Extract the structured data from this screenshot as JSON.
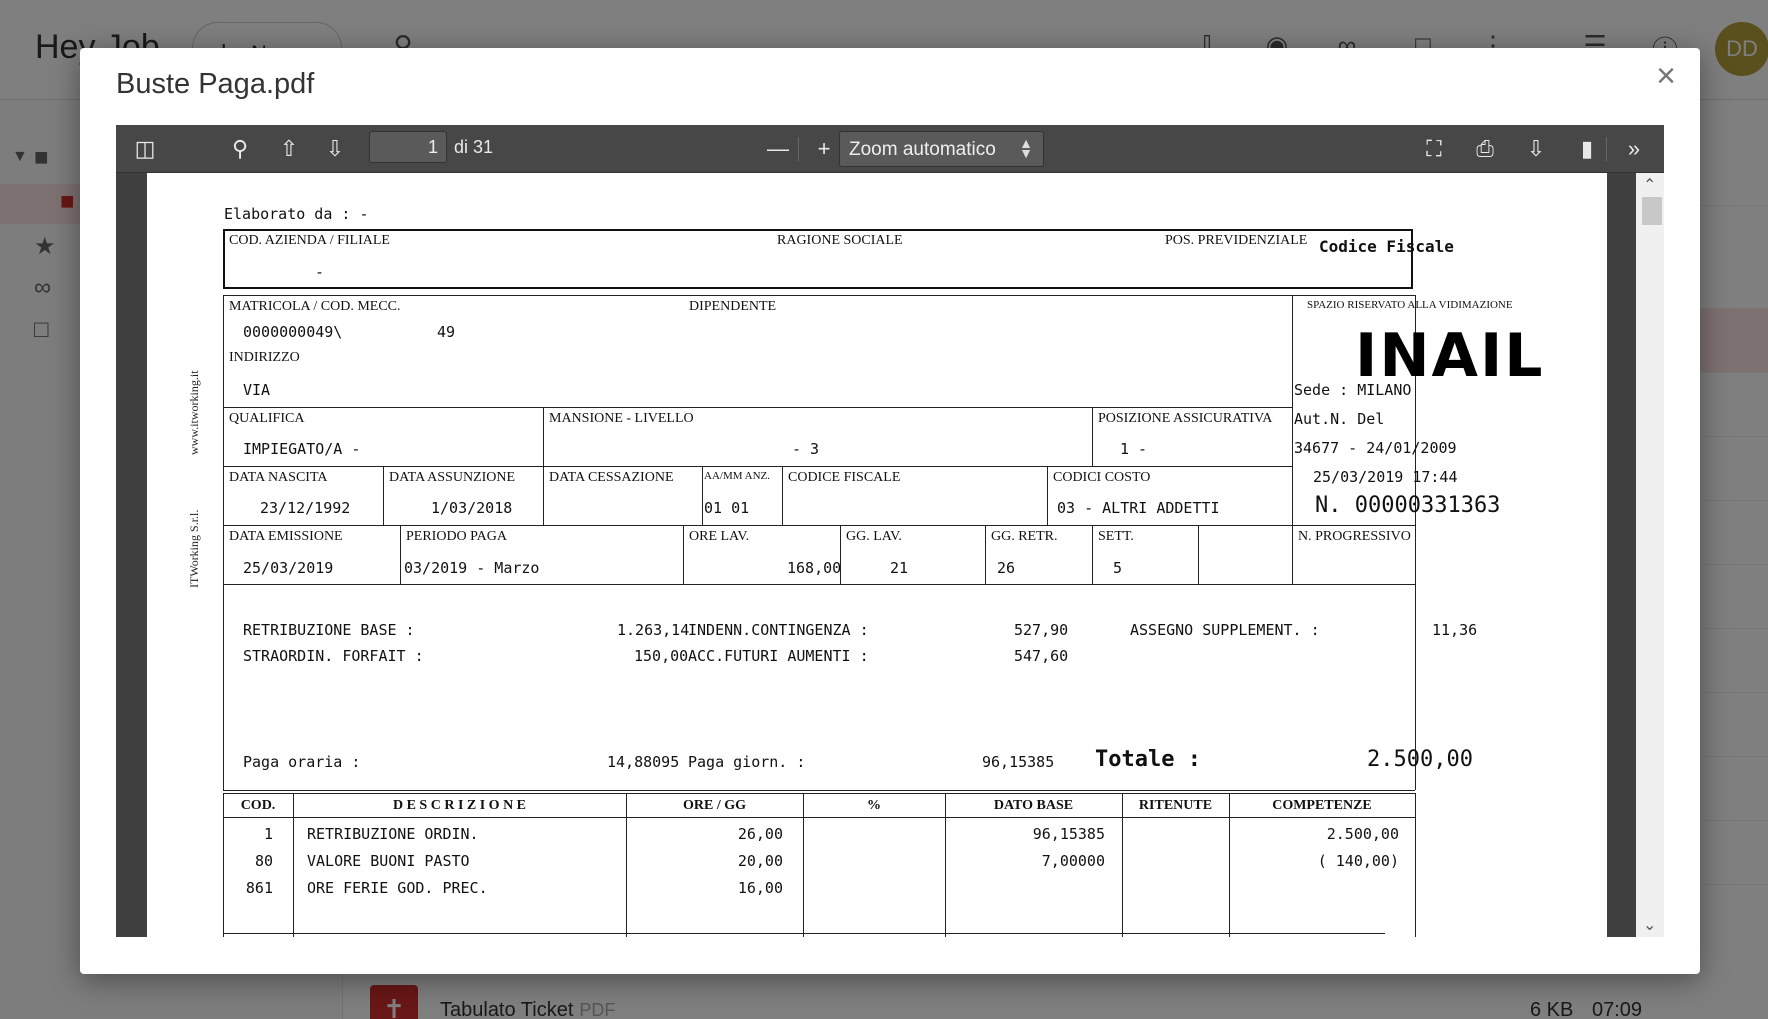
{
  "app": {
    "title": "Hey Job",
    "new_button": "Nuovo",
    "avatar_initials": "DD",
    "bottom_file": {
      "name": "Tabulato Ticket",
      "type": "PDF",
      "size": "6 KB",
      "time": "07:09"
    }
  },
  "modal": {
    "title": "Buste Paga.pdf"
  },
  "toolbar": {
    "page_number": "1",
    "page_count": "di 31",
    "zoom": "Zoom automatico"
  },
  "payslip": {
    "elaborato_da": "Elaborato da : -",
    "side_text_1": "www.itworking.it",
    "side_text_2": "ITWorking S.r.l.",
    "labels": {
      "cod_azienda": "COD. AZIENDA / FILIALE",
      "ragione_sociale": "RAGIONE SOCIALE",
      "pos_previdenziale": "POS. PREVIDENZIALE",
      "codice_fiscale_top": "Codice Fiscale",
      "matricola": "MATRICOLA / COD. MECC.",
      "dipendente": "DIPENDENTE",
      "indirizzo": "INDIRIZZO",
      "spazio_riservato": "SPAZIO RISERVATO ALLA VIDIMAZIONE",
      "qualifica": "QUALIFICA",
      "mansione": "MANSIONE - LIVELLO",
      "posizione_assicurativa": "POSIZIONE ASSICURATIVA",
      "data_nascita": "DATA NASCITA",
      "data_assunzione": "DATA ASSUNZIONE",
      "data_cessazione": "DATA CESSAZIONE",
      "aa_mm_anz": "AA/MM ANZ.",
      "codice_fiscale": "CODICE FISCALE",
      "codici_costo": "CODICI COSTO",
      "data_emissione": "DATA EMISSIONE",
      "periodo_paga": "PERIODO PAGA",
      "ore_lav": "ORE LAV.",
      "gg_lav": "GG. LAV.",
      "gg_retr": "GG. RETR.",
      "sett": "SETT.",
      "n_progressivo": "N. PROGRESSIVO"
    },
    "values": {
      "cod_azienda": "-",
      "matricola": "0000000049\\",
      "cod_mecc": "49",
      "indirizzo": "VIA",
      "qualifica": "IMPIEGATO/A -",
      "mansione": "- 3",
      "posizione_assicurativa": "1 -",
      "data_nascita": "23/12/1992",
      "data_assunzione": "1/03/2018",
      "aa_mm_anz": "01 01",
      "codici_costo": "03 - ALTRI ADDETTI",
      "data_emissione": "25/03/2019",
      "periodo_paga": "03/2019 - Marzo",
      "ore_lav": "168,00",
      "gg_lav": "21",
      "gg_retr": "26",
      "sett": "5"
    },
    "inail": {
      "logo": "INAIL",
      "sede": "Sede    : MILANO",
      "aut": "Aut.N.   Del",
      "aut_num": "34677 - 24/01/2009",
      "timestamp": "25/03/2019 17:44",
      "numero": "N. 00000331363"
    },
    "elements": [
      {
        "label": "RETRIBUZIONE BASE   :",
        "value": "1.263,14"
      },
      {
        "label": "INDENN.CONTINGENZA  :",
        "value": "527,90"
      },
      {
        "label": "ASSEGNO SUPPLEMENT. :",
        "value": "11,36"
      },
      {
        "label": "STRAORDIN. FORFAIT  :",
        "value": "150,00"
      },
      {
        "label": "ACC.FUTURI AUMENTI  :",
        "value": "547,60"
      }
    ],
    "paga_oraria": {
      "label": "Paga oraria         :",
      "value": "14,88095"
    },
    "paga_giorn": {
      "label": "Paga giorn.         :",
      "value": "96,15385"
    },
    "totale": {
      "label": "Totale  :",
      "value": "2.500,00"
    },
    "table": {
      "headers": [
        "COD.",
        "D E S C R I Z I O N E",
        "ORE / GG",
        "%",
        "DATO BASE",
        "RITENUTE",
        "COMPETENZE"
      ],
      "rows": [
        {
          "cod": "1",
          "desc": "RETRIBUZIONE ORDIN.",
          "ore": "26,00",
          "pct": "",
          "dato": "96,15385",
          "rit": "",
          "comp": "2.500,00"
        },
        {
          "cod": "80",
          "desc": "VALORE BUONI PASTO",
          "ore": "20,00",
          "pct": "",
          "dato": "7,00000",
          "rit": "",
          "comp": "(        140,00)"
        },
        {
          "cod": "861",
          "desc": "ORE FERIE GOD. PREC.",
          "ore": "16,00",
          "pct": "",
          "dato": "",
          "rit": "",
          "comp": ""
        }
      ]
    }
  }
}
